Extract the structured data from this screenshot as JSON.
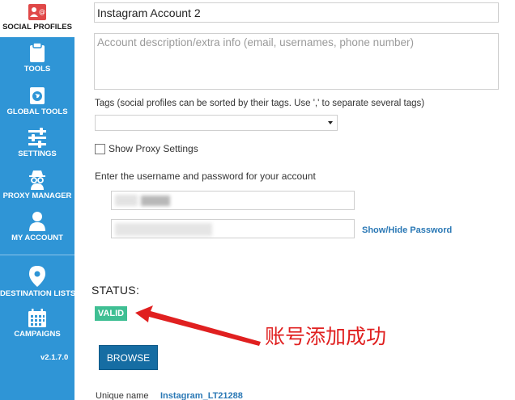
{
  "sidebar": {
    "items": [
      {
        "label": "SOCIAL PROFILES",
        "icon": "social-profiles-icon",
        "active": true
      },
      {
        "label": "TOOLS",
        "icon": "clipboard-icon"
      },
      {
        "label": "GLOBAL TOOLS",
        "icon": "globe-icon"
      },
      {
        "label": "SETTINGS",
        "icon": "sliders-icon"
      },
      {
        "label": "PROXY MANAGER",
        "icon": "spy-icon"
      },
      {
        "label": "MY ACCOUNT",
        "icon": "user-icon"
      },
      {
        "label": "DESTINATION LISTS",
        "icon": "map-pin-icon"
      },
      {
        "label": "CAMPAIGNS",
        "icon": "calendar-icon"
      }
    ],
    "version": "v2.1.7.0"
  },
  "form": {
    "account_name": "Instagram Account 2",
    "description_placeholder": "Account description/extra info (email, usernames, phone number)",
    "tags_hint": "Tags (social profiles can be sorted by their tags. Use ',' to separate several tags)",
    "proxy_label": "Show Proxy Settings",
    "credentials_hint": "Enter the username and password for your account",
    "show_hide_password": "Show/Hide Password"
  },
  "status": {
    "label": "STATUS:",
    "value": "VALID",
    "annotation": "账号添加成功"
  },
  "browse_label": "BROWSE",
  "unique_name": {
    "label": "Unique name",
    "value": "Instagram_LT21288"
  },
  "colors": {
    "sidebar": "#2f95d6",
    "valid": "#3fbf93",
    "button": "#166da3",
    "link": "#2a78b5",
    "annotation": "#e02020"
  }
}
